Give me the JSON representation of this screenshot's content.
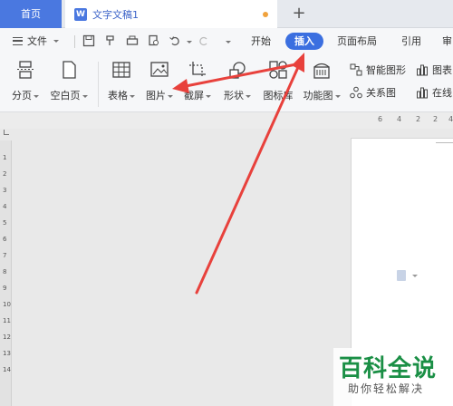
{
  "tabs": {
    "home_label": "首页",
    "doc_title": "文字文稿1",
    "doc_icon_letter": "W",
    "add_label": "+"
  },
  "menu": {
    "file_label": "文件",
    "items": [
      "开始",
      "插入",
      "页面布局",
      "引用",
      "审"
    ],
    "active_item": "插入"
  },
  "ribbon": {
    "page_break": "分页",
    "blank_page": "空白页",
    "table": "表格",
    "picture": "图片",
    "screenshot": "截屏",
    "shapes": "形状",
    "icons": "图标库",
    "function_chart": "功能图",
    "smart_art": "智能图形",
    "chart": "图表",
    "relation_chart": "关系图",
    "online": "在线"
  },
  "ruler_top": [
    "6",
    "4",
    "2",
    "2",
    "4"
  ],
  "ruler_left": [
    "1",
    "2",
    "3",
    "4",
    "5",
    "6",
    "7",
    "8",
    "9",
    "10",
    "11",
    "12",
    "13",
    "14"
  ],
  "watermark": {
    "title": "百科全说",
    "subtitle": "助你轻松解决"
  },
  "colors": {
    "accent": "#3b6fe0",
    "arrow": "#e8413c",
    "watermark": "#1a8f45"
  }
}
